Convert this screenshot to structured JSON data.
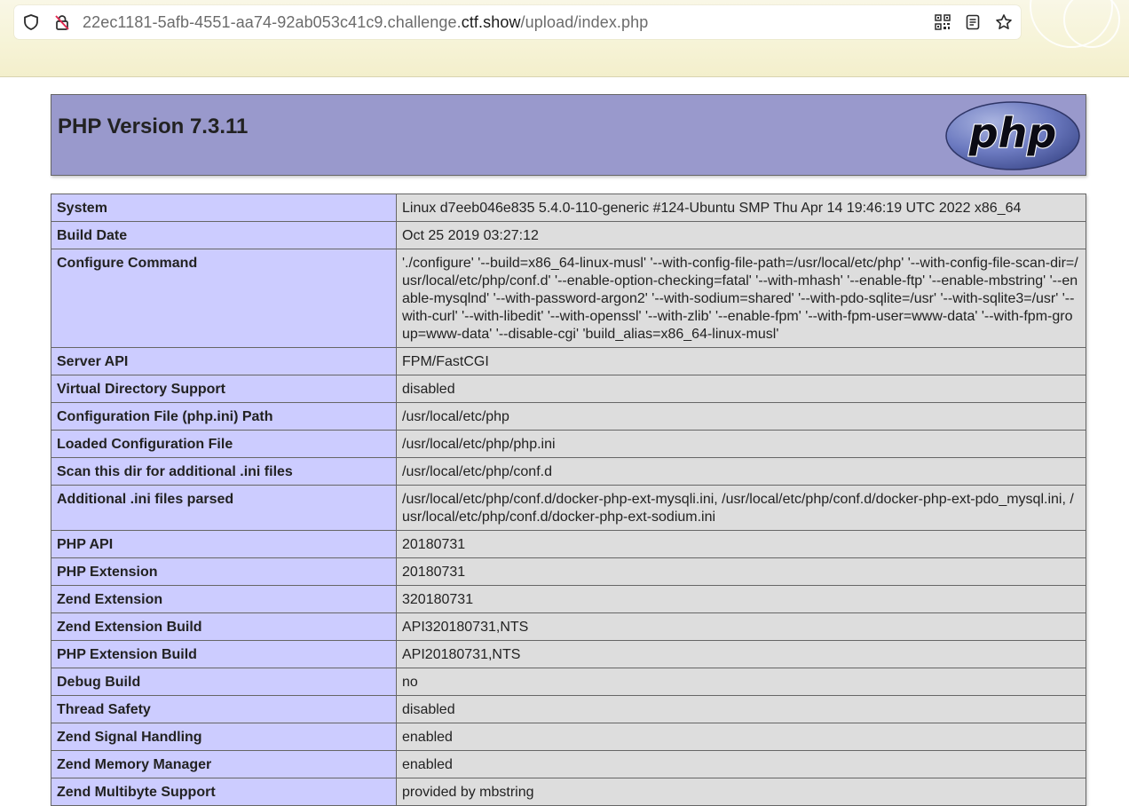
{
  "browser": {
    "url_prefix": "22ec1181-5afb-4551-aa74-92ab053c41c9.challenge.",
    "url_host": "ctf.show",
    "url_path": "/upload/index.php"
  },
  "php": {
    "title": "PHP Version 7.3.11",
    "logo_text": "php",
    "header_color": "#9999cc",
    "key_color": "#ccccff",
    "value_color": "#dddddd"
  },
  "rows": [
    {
      "key": "System",
      "value": "Linux d7eeb046e835 5.4.0-110-generic #124-Ubuntu SMP Thu Apr 14 19:46:19 UTC 2022 x86_64"
    },
    {
      "key": "Build Date",
      "value": "Oct 25 2019 03:27:12"
    },
    {
      "key": "Configure Command",
      "value": "'./configure' '--build=x86_64-linux-musl' '--with-config-file-path=/usr/local/etc/php' '--with-config-file-scan-dir=/usr/local/etc/php/conf.d' '--enable-option-checking=fatal' '--with-mhash' '--enable-ftp' '--enable-mbstring' '--enable-mysqlnd' '--with-password-argon2' '--with-sodium=shared' '--with-pdo-sqlite=/usr' '--with-sqlite3=/usr' '--with-curl' '--with-libedit' '--with-openssl' '--with-zlib' '--enable-fpm' '--with-fpm-user=www-data' '--with-fpm-group=www-data' '--disable-cgi' 'build_alias=x86_64-linux-musl'"
    },
    {
      "key": "Server API",
      "value": "FPM/FastCGI"
    },
    {
      "key": "Virtual Directory Support",
      "value": "disabled"
    },
    {
      "key": "Configuration File (php.ini) Path",
      "value": "/usr/local/etc/php"
    },
    {
      "key": "Loaded Configuration File",
      "value": "/usr/local/etc/php/php.ini"
    },
    {
      "key": "Scan this dir for additional .ini files",
      "value": "/usr/local/etc/php/conf.d"
    },
    {
      "key": "Additional .ini files parsed",
      "value": "/usr/local/etc/php/conf.d/docker-php-ext-mysqli.ini, /usr/local/etc/php/conf.d/docker-php-ext-pdo_mysql.ini, /usr/local/etc/php/conf.d/docker-php-ext-sodium.ini"
    },
    {
      "key": "PHP API",
      "value": "20180731"
    },
    {
      "key": "PHP Extension",
      "value": "20180731"
    },
    {
      "key": "Zend Extension",
      "value": "320180731"
    },
    {
      "key": "Zend Extension Build",
      "value": "API320180731,NTS"
    },
    {
      "key": "PHP Extension Build",
      "value": "API20180731,NTS"
    },
    {
      "key": "Debug Build",
      "value": "no"
    },
    {
      "key": "Thread Safety",
      "value": "disabled"
    },
    {
      "key": "Zend Signal Handling",
      "value": "enabled"
    },
    {
      "key": "Zend Memory Manager",
      "value": "enabled"
    },
    {
      "key": "Zend Multibyte Support",
      "value": "provided by mbstring"
    }
  ]
}
